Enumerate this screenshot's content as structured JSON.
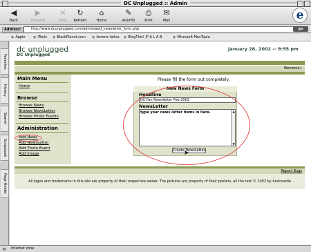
{
  "window": {
    "title": "DC Unplugged :: Admin"
  },
  "toolbar": {
    "back": "Back",
    "forward": "Forward",
    "stop": "Stop",
    "refresh": "Refresh",
    "home": "Home",
    "autofill": "AutoFill",
    "print": "Print",
    "mail": "Mail"
  },
  "address": {
    "label": "Address:",
    "url": "http://www.dcunplugged.com/admin/add_newsletter_form.php",
    "go": "go"
  },
  "favorites": [
    "Apple",
    "iTools",
    "BlackPlanet.com",
    "femme latina",
    "BlogThis! |P A L A B",
    "Microsoft MacTopia"
  ],
  "sidetabs": [
    "Favorites",
    "History",
    "Search",
    "Scrapbook",
    "Page Holder"
  ],
  "site": {
    "name": "dc unplugged",
    "subtitle": "DC Unplugged",
    "datetime": "January 28, 2002 -- 9:55 pm",
    "welcome": "Welcome::"
  },
  "nav": {
    "main_menu": "Main Menu",
    "home": "Home",
    "browse": "Browse",
    "browse_news": "Browse News",
    "browse_newsletter": "Browse NewsLetter",
    "browse_photo_events": "Browse Photo Events",
    "administration": "Administration",
    "add_news": "Add News",
    "add_newsletter": "Add NewsLetter",
    "add_photo_event": "Add Photo Event",
    "add_image": "Add Image"
  },
  "form": {
    "instruction": "Please fill the form out completely.",
    "title": "New News Form",
    "headline_label": "Headline",
    "headline_value": "DC Fan Newsletter Feb 2002",
    "newsletter_label": "NewsLetter",
    "newsletter_value": "type your news letter items in here.",
    "submit": "Create NewsLetter"
  },
  "footer": {
    "report_bugs": "Report Bugs",
    "copyright": "All logos and trademarks in this site are property of their respective owner. The pictures are property of their posters, all the rest © 2002 by funkmedia"
  },
  "status": {
    "text": "Internet zone"
  },
  "colors": {
    "accent": "#8a9a52",
    "panel": "#dfe3cc",
    "annotation": "#e24a4a"
  }
}
